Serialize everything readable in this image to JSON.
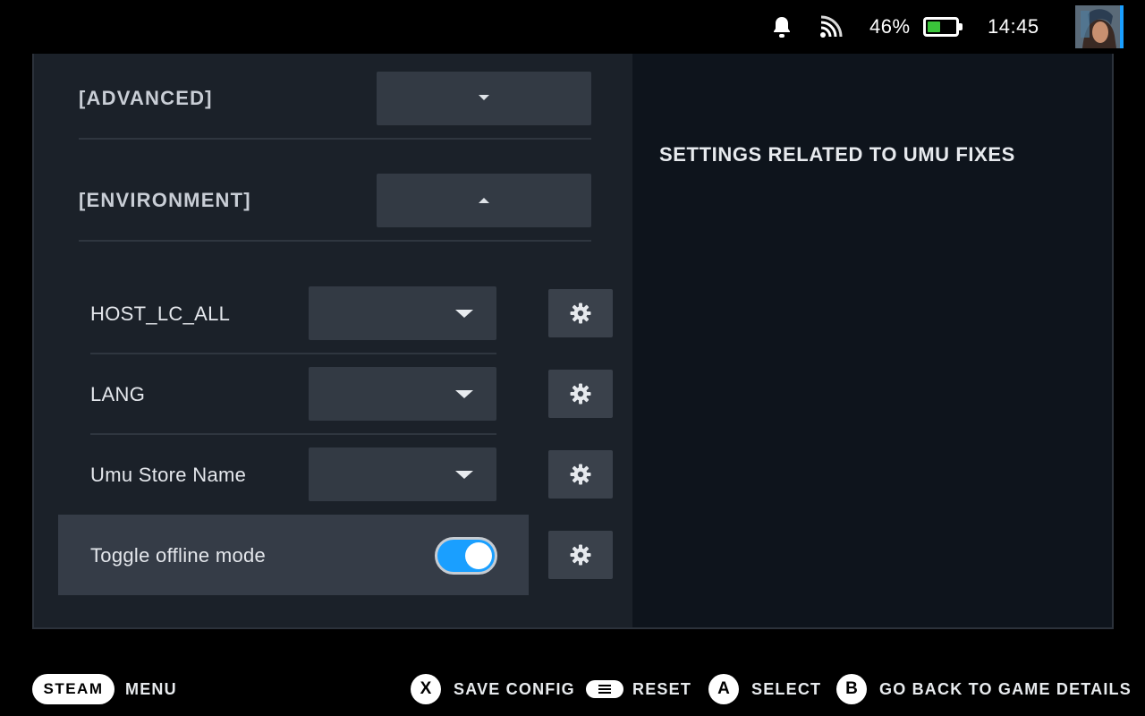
{
  "status_bar": {
    "battery_percent_text": "46%",
    "battery_level": 0.46,
    "clock": "14:45",
    "icons": [
      "bell-icon",
      "cast-icon",
      "battery-icon",
      "avatar"
    ],
    "battery_color": "#3ac43a"
  },
  "sections": [
    {
      "label": "[ADVANCED]",
      "expanded": false
    },
    {
      "label": "[ENVIRONMENT]",
      "expanded": true
    }
  ],
  "settings": [
    {
      "label": "HOST_LC_ALL",
      "type": "dropdown",
      "value": ""
    },
    {
      "label": "LANG",
      "type": "dropdown",
      "value": ""
    },
    {
      "label": "Umu Store Name",
      "type": "dropdown",
      "value": ""
    },
    {
      "label": "Toggle offline mode",
      "type": "toggle",
      "value": true
    }
  ],
  "description": "SETTINGS RELATED TO UMU FIXES",
  "footer": {
    "steam_label": "STEAM",
    "menu_label": "MENU",
    "save_glyph": "X",
    "save_label": "SAVE CONFIG",
    "reset_label": "RESET",
    "select_glyph": "A",
    "select_label": "SELECT",
    "back_glyph": "B",
    "back_label": "GO BACK TO GAME DETAILS"
  },
  "colors": {
    "accent_toggle": "#1a9fff",
    "panel_left": "#1b2129",
    "panel_right": "#0e141c",
    "control_bg": "#333a44"
  }
}
